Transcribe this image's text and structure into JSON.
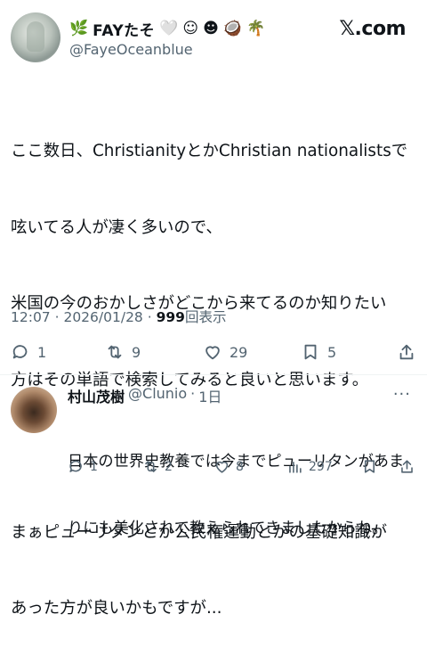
{
  "header": {
    "display_name": "FAYたそ",
    "emojis": [
      "🌿",
      "🤍",
      "☺",
      "☻",
      "🥥",
      "🌴"
    ],
    "handle": "@FayeOceanblue",
    "watermark": "𝕏.com"
  },
  "tweet": {
    "lines": [
      "ここ数日、ChristianityとかChristian nationalistsで",
      "呟いてる人が凄く多いので、",
      "米国の今のおかしさがどこから来てるのか知りたい",
      "方はその単語で検索してみると良いと思います。",
      "",
      "まぁピューリタンとか公民権運動とかの基礎知識が",
      "あった方が良いかもですが..."
    ],
    "time": "12:07",
    "date": "2026/01/28",
    "view_count": "999",
    "view_label": "回表示",
    "separator": " · "
  },
  "actions": {
    "replies": "1",
    "reposts": "9",
    "likes": "29",
    "bookmarks": "5"
  },
  "reply": {
    "name": "村山茂樹",
    "handle": "@Clunio",
    "age": "1日",
    "more": "···",
    "lines": [
      "日本の世界史教養では今までピューリタンがあま",
      "りにも美化されて教えられてきましたからね。"
    ],
    "replies": "1",
    "reposts": "2",
    "likes": "8",
    "views": "297"
  }
}
